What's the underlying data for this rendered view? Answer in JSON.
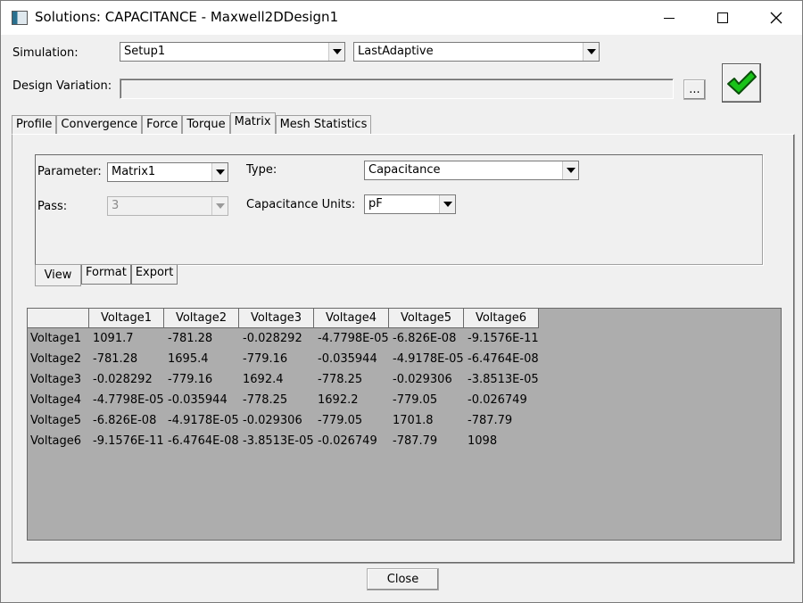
{
  "window": {
    "title": "Solutions: CAPACITANCE - Maxwell2DDesign1",
    "controls": [
      "minimize",
      "maximize",
      "close"
    ]
  },
  "simulation": {
    "label": "Simulation:",
    "setup_value": "Setup1",
    "solution_value": "LastAdaptive"
  },
  "design_variation": {
    "label": "Design Variation:",
    "value": "",
    "browse_label": "..."
  },
  "apply_icon": "green-checkmark-icon",
  "tabs": [
    {
      "label": "Profile"
    },
    {
      "label": "Convergence"
    },
    {
      "label": "Force"
    },
    {
      "label": "Torque"
    },
    {
      "label": "Matrix"
    },
    {
      "label": "Mesh Statistics"
    }
  ],
  "active_tab": "Matrix",
  "matrix": {
    "parameter_label": "Parameter:",
    "parameter_value": "Matrix1",
    "pass_label": "Pass:",
    "pass_value": "3",
    "type_label": "Type:",
    "type_value": "Capacitance",
    "units_label": "Capacitance Units:",
    "units_value": "pF"
  },
  "subtabs": [
    {
      "label": "View"
    },
    {
      "label": "Format"
    },
    {
      "label": "Export"
    }
  ],
  "grid": {
    "columns": [
      "Voltage1",
      "Voltage2",
      "Voltage3",
      "Voltage4",
      "Voltage5",
      "Voltage6"
    ],
    "rows": [
      {
        "name": "Voltage1",
        "cells": [
          "1091.7",
          "-781.28",
          "-0.028292",
          "-4.7798E-05",
          "-6.826E-08",
          "-9.1576E-11"
        ]
      },
      {
        "name": "Voltage2",
        "cells": [
          "-781.28",
          "1695.4",
          "-779.16",
          "-0.035944",
          "-4.9178E-05",
          "-6.4764E-08"
        ]
      },
      {
        "name": "Voltage3",
        "cells": [
          "-0.028292",
          "-779.16",
          "1692.4",
          "-778.25",
          "-0.029306",
          "-3.8513E-05"
        ]
      },
      {
        "name": "Voltage4",
        "cells": [
          "-4.7798E-05",
          "-0.035944",
          "-778.25",
          "1692.2",
          "-779.05",
          "-0.026749"
        ]
      },
      {
        "name": "Voltage5",
        "cells": [
          "-6.826E-08",
          "-4.9178E-05",
          "-0.029306",
          "-779.05",
          "1701.8",
          "-787.79"
        ]
      },
      {
        "name": "Voltage6",
        "cells": [
          "-9.1576E-11",
          "-6.4764E-08",
          "-3.8513E-05",
          "-0.026749",
          "-787.79",
          "1098"
        ]
      }
    ]
  },
  "close_button": {
    "label": "Close"
  }
}
